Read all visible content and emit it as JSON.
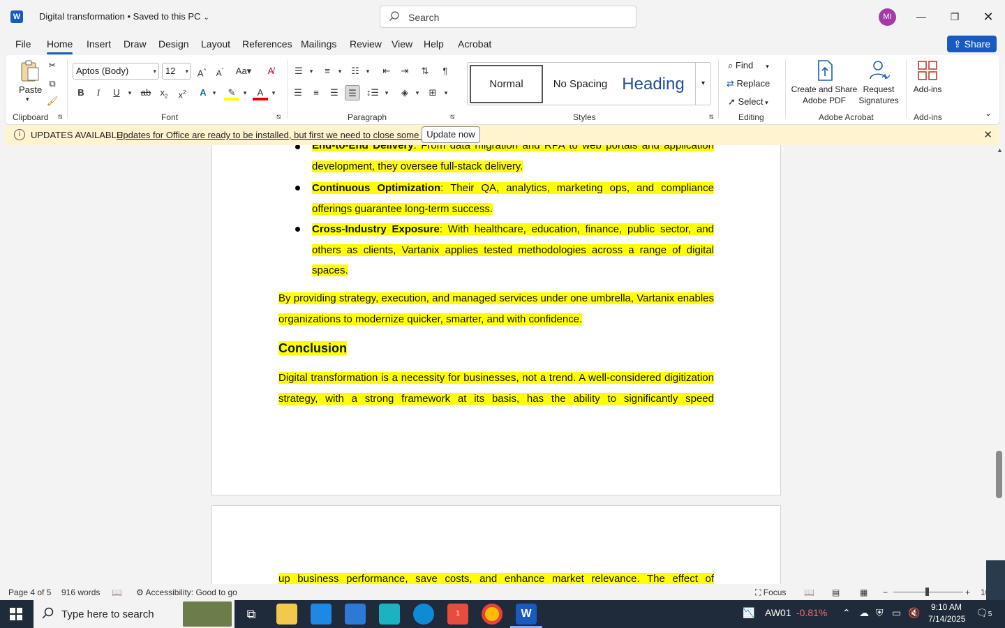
{
  "titlebar": {
    "doc_title": "Digital transformation • Saved to this PC",
    "search_placeholder": "Search",
    "avatar_initials": "MI"
  },
  "tabs": [
    "File",
    "Home",
    "Insert",
    "Draw",
    "Design",
    "Layout",
    "References",
    "Mailings",
    "Review",
    "View",
    "Help",
    "Acrobat"
  ],
  "share_label": "Share",
  "ribbon": {
    "clipboard": {
      "paste": "Paste",
      "label": "Clipboard"
    },
    "font": {
      "name": "Aptos (Body)",
      "size": "12",
      "label": "Font"
    },
    "paragraph": {
      "label": "Paragraph"
    },
    "styles": {
      "normal": "Normal",
      "nospacing": "No Spacing",
      "heading": "Heading",
      "label": "Styles"
    },
    "editing": {
      "find": "Find",
      "replace": "Replace",
      "select": "Select",
      "label": "Editing"
    },
    "acrobat": {
      "create": "Create and Share Adobe PDF",
      "request": "Request Signatures",
      "label": "Adobe Acrobat"
    },
    "addins": {
      "button": "Add-ins",
      "label": "Add-ins"
    }
  },
  "update_bar": {
    "title": "UPDATES AVAILABLE",
    "message": "Updates for Office are ready to be installed, but first we need to close some apps.",
    "button": "Update now"
  },
  "document": {
    "bullets": [
      {
        "term": "End-to-End Delivery",
        "text": ": From data migration and RPA to web portals and application development, they oversee full-stack delivery."
      },
      {
        "term": "Continuous Optimization",
        "text": ": Their QA, analytics, marketing ops, and compliance offerings guarantee long-term success."
      },
      {
        "term": "Cross-Industry Exposure",
        "text": ": With healthcare, education, finance, public sector, and others as clients, Vartanix applies tested methodologies across a range of digital spaces."
      }
    ],
    "para1": "By providing strategy, execution, and managed services under one umbrella, Vartanix enables organizations to modernize quicker, smarter, and with confidence.",
    "heading": "Conclusion",
    "para2": "Digital transformation is a necessity for businesses, not a trend. A well-considered digitization strategy, with a strong framework at its basis, has the ability to significantly speed",
    "para3": "up business performance, save costs, and enhance market relevance. The effect of"
  },
  "status": {
    "page": "Page 4 of 5",
    "words": "916 words",
    "accessibility": "Accessibility: Good to go",
    "focus": "Focus",
    "zoom": "10"
  },
  "taskbar": {
    "search": "Type here to search",
    "stock_name": "AW01",
    "stock_change": "-0.81%",
    "time": "9:10 AM",
    "date": "7/14/2025",
    "notif_count": "5",
    "zoom_badge": "1"
  }
}
